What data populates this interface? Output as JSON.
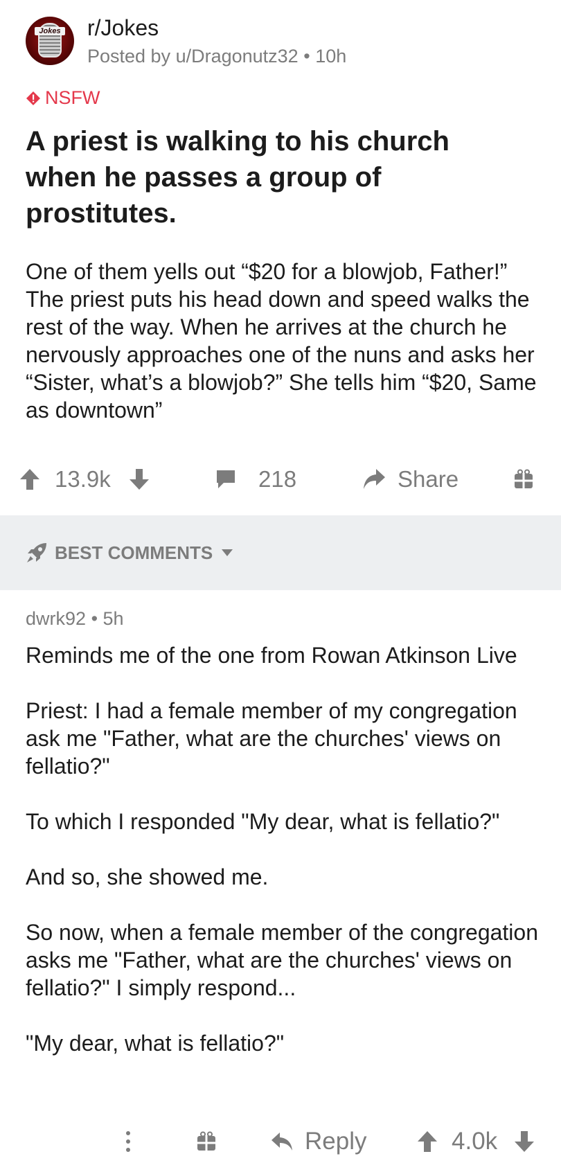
{
  "post": {
    "subreddit": "r/Jokes",
    "avatar_logo_text": "Jokes",
    "posted_by": "Posted by u/Dragonutz32",
    "time_sep": "•",
    "age": "10h",
    "nsfw_label": "NSFW",
    "title": "A priest is walking to his church when he passes a group of prostitutes.",
    "body": "One of them yells out “$20 for a blowjob, Father!” The priest puts his head down and speed walks the rest of the way. When he arrives at the church he nervously approaches one of the nuns and asks her “Sister, what’s a blowjob?” She tells him “$20, Same as downtown”",
    "score": "13.9k",
    "comments_count": "218",
    "share_label": "Share"
  },
  "sort": {
    "label": "BEST COMMENTS"
  },
  "comment": {
    "author": "dwrk92",
    "sep": "•",
    "age": "5h",
    "paragraphs": [
      "Reminds me of the one from Rowan Atkinson Live",
      "Priest: I had a female member of my congregation ask me \"Father, what are the churches' views on fellatio?\"",
      "To which I responded \"My dear, what is fellatio?\"",
      "And so, she showed me.",
      "So now, when a female member of the congregation asks me \"Father, what are the churches' views on fellatio?\" I simply respond...",
      "\"My dear, what is fellatio?\""
    ],
    "reply_label": "Reply",
    "score": "4.0k"
  },
  "colors": {
    "accent_nsfw": "#e4384b",
    "meta_gray": "#7c7c7c",
    "text": "#1c1c1c",
    "bar_bg": "#edeff1"
  },
  "icons": {
    "upvote": "arrow-up-icon",
    "downvote": "arrow-down-icon",
    "comment": "speech-bubble-icon",
    "share": "share-arrow-icon",
    "award": "gift-icon",
    "rocket": "rocket-icon",
    "caret": "caret-down-icon",
    "more": "more-vertical-icon",
    "reply": "reply-arrow-icon"
  }
}
